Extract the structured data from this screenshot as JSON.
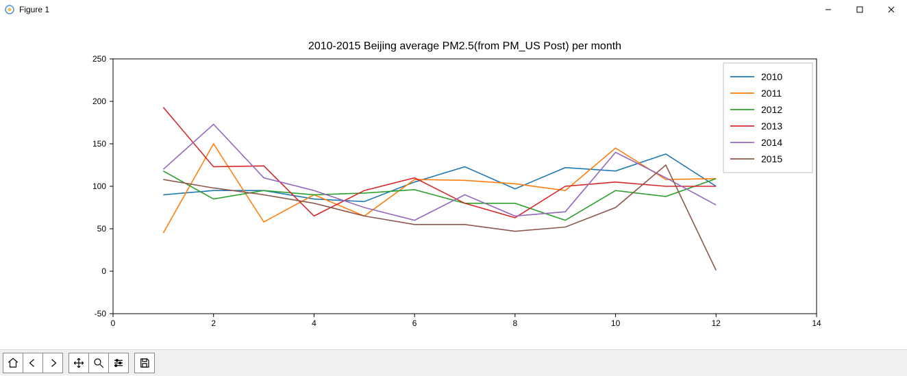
{
  "window": {
    "title": "Figure 1"
  },
  "toolbar": {
    "home": "Home",
    "back": "Back",
    "forward": "Forward",
    "pan": "Pan",
    "zoom": "Zoom",
    "configure": "Configure subplots",
    "save": "Save"
  },
  "chart_data": {
    "type": "line",
    "title": "2010-2015 Beijing average PM2.5(from PM_US Post) per month",
    "xlabel": "",
    "ylabel": "",
    "xlim": [
      0,
      14
    ],
    "ylim": [
      -50,
      250
    ],
    "xticks": [
      0,
      2,
      4,
      6,
      8,
      10,
      12,
      14
    ],
    "yticks": [
      -50,
      0,
      50,
      100,
      150,
      200,
      250
    ],
    "x": [
      1,
      2,
      3,
      4,
      5,
      6,
      7,
      8,
      9,
      10,
      11,
      12
    ],
    "series": [
      {
        "name": "2010",
        "color": "#1f77b4",
        "values": [
          90,
          95,
          95,
          85,
          82,
          105,
          123,
          97,
          122,
          118,
          138,
          100
        ]
      },
      {
        "name": "2011",
        "color": "#ff7f0e",
        "values": [
          45,
          150,
          58,
          90,
          65,
          108,
          107,
          103,
          95,
          145,
          108,
          109
        ]
      },
      {
        "name": "2012",
        "color": "#2ca02c",
        "values": [
          118,
          85,
          95,
          90,
          92,
          96,
          80,
          80,
          60,
          95,
          88,
          109
        ]
      },
      {
        "name": "2013",
        "color": "#d62728",
        "values": [
          193,
          123,
          124,
          65,
          95,
          110,
          80,
          63,
          100,
          105,
          100,
          100
        ]
      },
      {
        "name": "2014",
        "color": "#9467bd",
        "values": [
          120,
          173,
          110,
          95,
          75,
          60,
          90,
          65,
          70,
          140,
          110,
          78
        ]
      },
      {
        "name": "2015",
        "color": "#8c564b",
        "values": [
          108,
          98,
          90,
          80,
          65,
          55,
          55,
          47,
          52,
          75,
          125,
          1
        ]
      }
    ],
    "legend_position": "upper right"
  }
}
